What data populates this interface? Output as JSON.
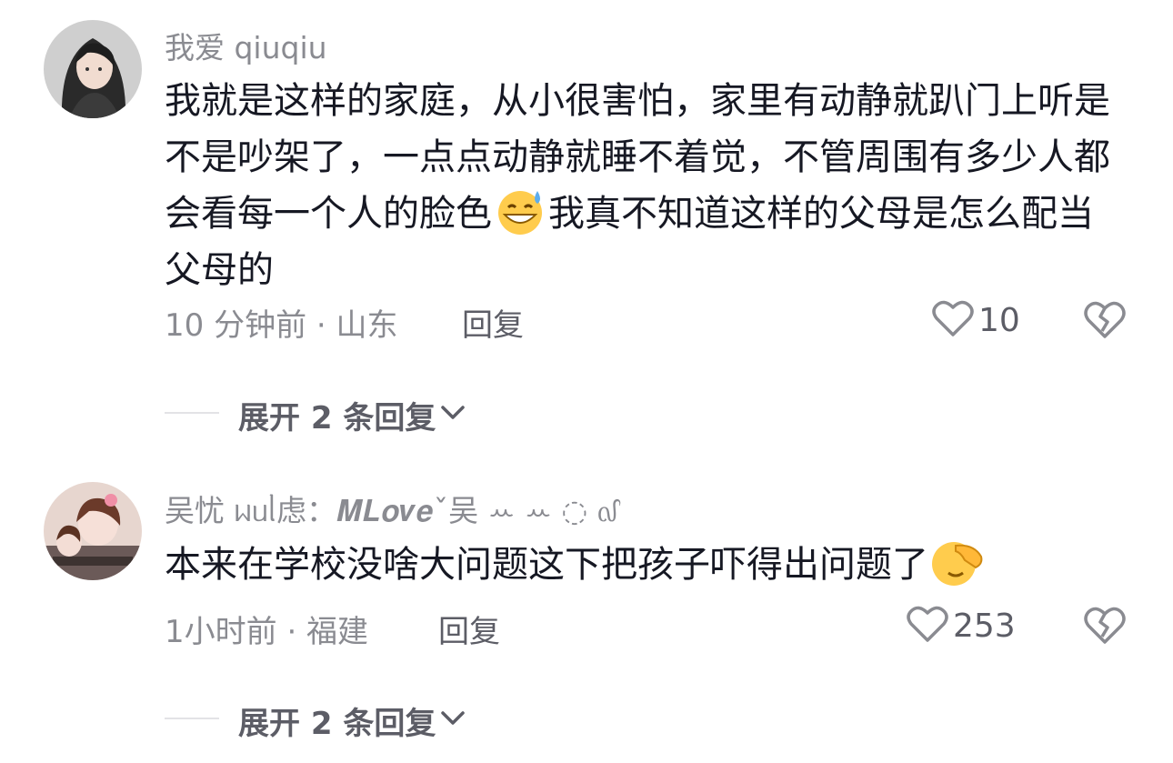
{
  "comments": [
    {
      "username": "我爱 qiuqiu",
      "text_parts": [
        "我就是这样的家庭，从小很害怕，家里有动静就趴门上听是不是吵架了，一点点动静就睡不着觉，不管周围有多少人都会看每一个人的脸色",
        "我真不知道这样的父母是怎么配当父母的"
      ],
      "emoji": "grinning-sweat-emoji",
      "time": "10 分钟前 · 山东",
      "reply_label": "回复",
      "likes": "10",
      "expand_label": "展开 2 条回复"
    },
    {
      "username": "吴忧 ᥕᥙᥣ虑：𝑴𝑳𝒐𝒗𝒆ˇ吴 ꕀ ꕀ ◌ ᧞",
      "text_parts": [
        "本来在学校没啥大问题这下把孩子吓得出问题了",
        ""
      ],
      "emoji": "facepalm-emoji",
      "time": "1小时前 · 福建",
      "reply_label": "回复",
      "likes": "253",
      "expand_label": "展开 2 条回复"
    }
  ]
}
